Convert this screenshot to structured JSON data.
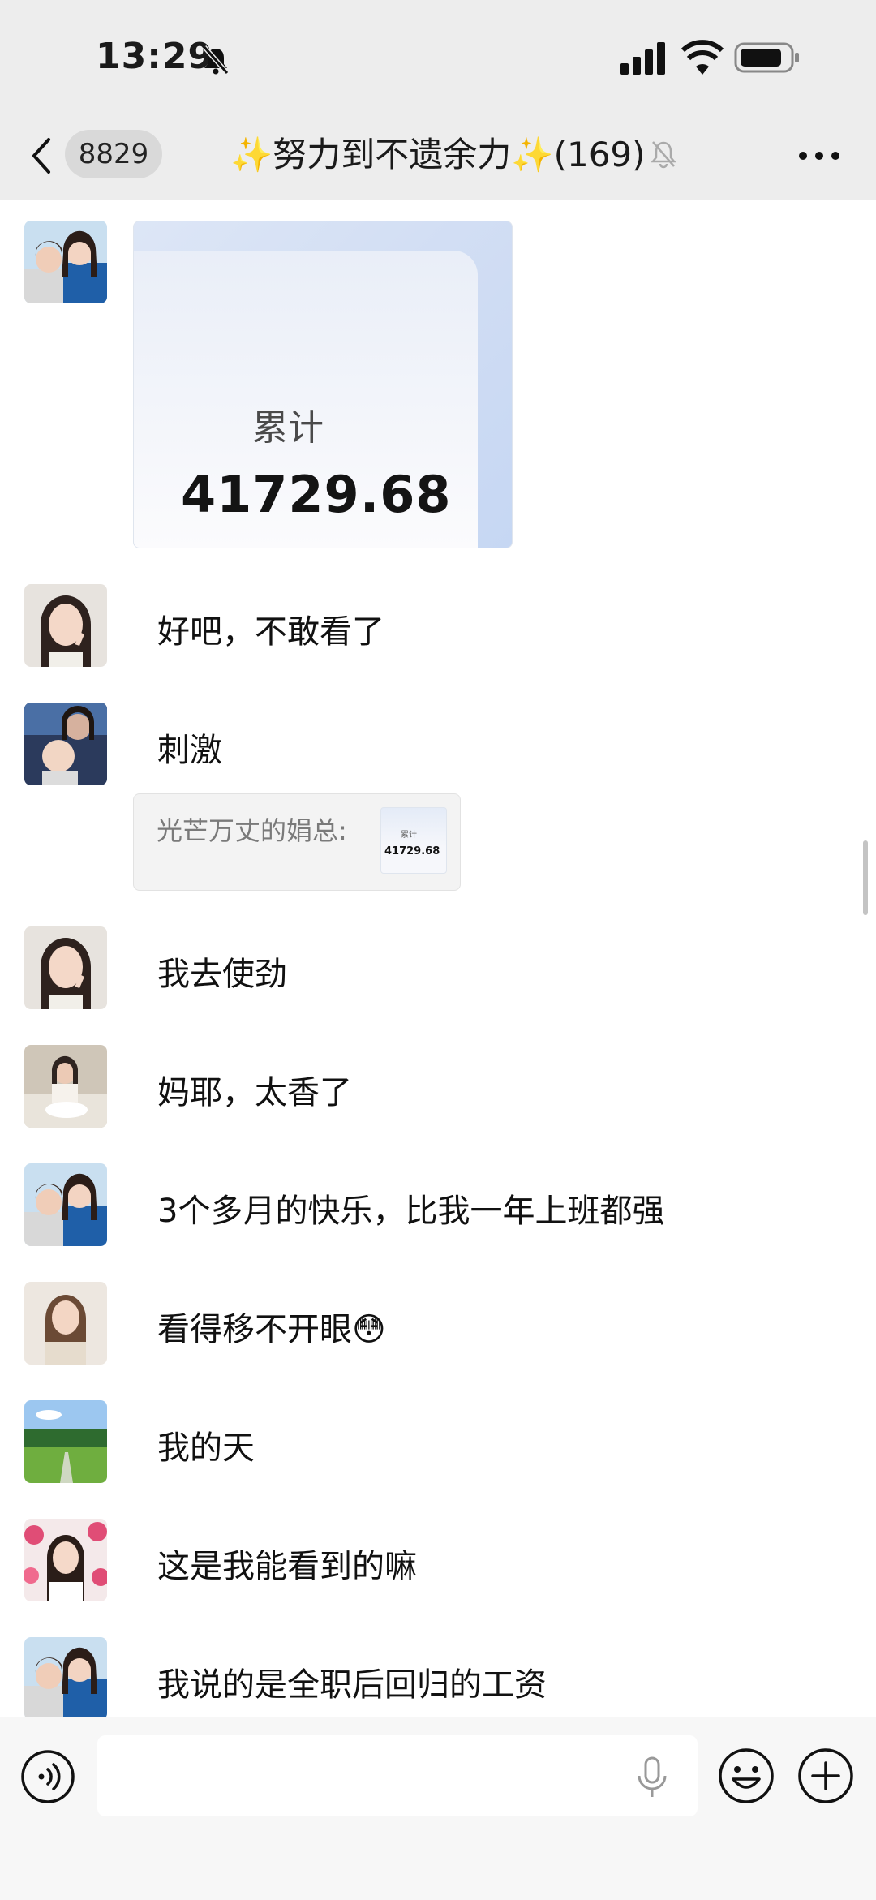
{
  "status_bar": {
    "time": "13:29"
  },
  "nav": {
    "unread_count": "8829",
    "title": "✨努力到不遗余力✨(169)"
  },
  "messages": [
    {
      "id": "m1",
      "type": "image",
      "image_label": "累计",
      "image_value": "41729.68"
    },
    {
      "id": "m2",
      "type": "text",
      "text": "好吧，不敢看了"
    },
    {
      "id": "m3",
      "type": "text",
      "text": "刺激",
      "quote": {
        "text": "光芒万丈的娟总:",
        "thumb_label": "累计",
        "thumb_value": "41729.68"
      }
    },
    {
      "id": "m4",
      "type": "text",
      "text": "我去使劲"
    },
    {
      "id": "m5",
      "type": "text",
      "text": "妈耶，太香了"
    },
    {
      "id": "m6",
      "type": "text",
      "text": "3个多月的快乐，比我一年上班都强"
    },
    {
      "id": "m7",
      "type": "text",
      "text": "看得移不开眼😳"
    },
    {
      "id": "m8",
      "type": "text",
      "text": "我的天"
    },
    {
      "id": "m9",
      "type": "text",
      "text": "这是我能看到的嘛"
    },
    {
      "id": "m10",
      "type": "text",
      "text": "我说的是全职后回归的工资"
    }
  ],
  "input": {
    "value": "",
    "placeholder": ""
  },
  "icons": {
    "back": "chevron-left-icon",
    "mute": "bell-off-icon",
    "more": "more-horizontal-icon",
    "voice": "voice-icon",
    "mic": "microphone-icon",
    "emoji": "emoji-icon",
    "plus": "plus-icon"
  },
  "colors": {
    "header_bg": "#ededed",
    "chat_bg": "#ffffff",
    "input_bg": "#f7f7f7",
    "quote_bg": "#f3f3f3"
  }
}
